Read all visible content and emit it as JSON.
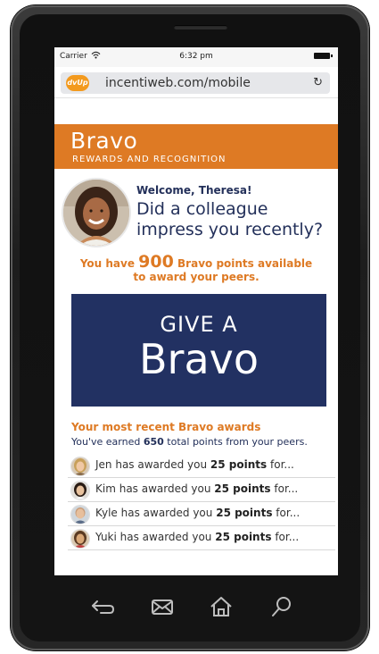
{
  "status": {
    "carrier": "Carrier",
    "time": "6:32 pm"
  },
  "browser": {
    "site_logo": "dvUp",
    "url": "incentiweb.com/mobile",
    "reload": "↻"
  },
  "header": {
    "title": "Bravo",
    "subtitle": "REWARDS AND RECOGNITION"
  },
  "welcome": {
    "greeting": "Welcome, Theresa!",
    "question": "Did a colleague impress you recently?"
  },
  "points": {
    "prefix": "You have",
    "value": "900",
    "suffix_1": "Bravo points available",
    "suffix_2": "to award your peers."
  },
  "give_button": {
    "line1": "GIVE A",
    "line2": "Bravo"
  },
  "recent": {
    "title": "Your most recent Bravo awards",
    "sub_prefix": "You've earned",
    "sub_value": "650",
    "sub_suffix": "total points from your peers.",
    "items": [
      {
        "name": "Jen",
        "pre": "Jen has awarded you",
        "points": "25 points",
        "post": "for..."
      },
      {
        "name": "Kim",
        "pre": "Kim has awarded you",
        "points": "25 points",
        "post": "for..."
      },
      {
        "name": "Kyle",
        "pre": "Kyle has awarded you",
        "points": "25 points",
        "post": "for..."
      },
      {
        "name": "Yuki",
        "pre": "Yuki has awarded you",
        "points": "25 points",
        "post": "for..."
      }
    ]
  },
  "colors": {
    "brand_orange": "#de7a24",
    "navy": "#223162"
  },
  "nav_icons": [
    "back-icon",
    "mail-icon",
    "home-icon",
    "search-icon"
  ]
}
